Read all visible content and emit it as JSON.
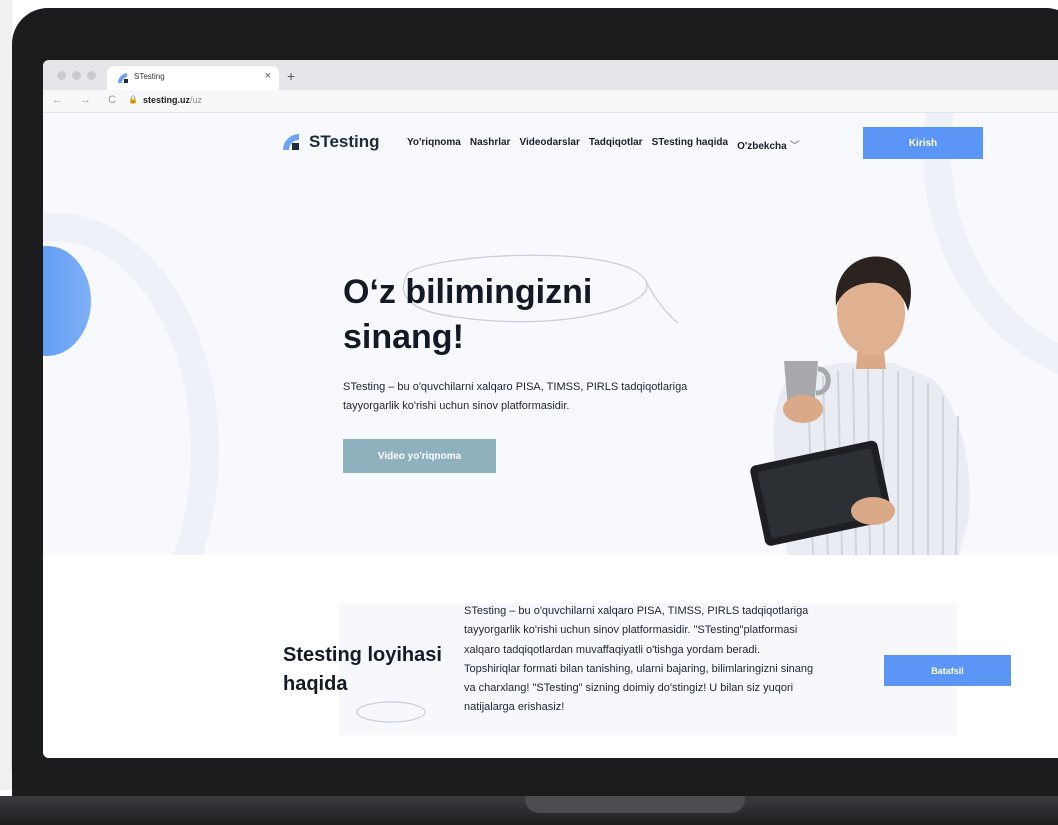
{
  "browser": {
    "tab_title": "STesting",
    "tab_close": "×",
    "new_tab": "+",
    "nav_buttons": "← → C",
    "url_domain": "stesting.uz",
    "url_path": "/uz"
  },
  "header": {
    "logo_text": "STesting",
    "menu": [
      {
        "label": "Yo'riqnoma"
      },
      {
        "label": "Nashrlar"
      },
      {
        "label": "Videodarslar"
      },
      {
        "label": "Tadqiqotlar"
      },
      {
        "label": "STesting haqida"
      },
      {
        "label": "O'zbekcha"
      }
    ],
    "lang_chevron": "﹀",
    "login_label": "Kirish"
  },
  "hero": {
    "title": "O‘z bilimingizni sinang!",
    "description": "STesting – bu o'quvchilarni xalqaro PISA, TIMSS, PIRLS tadqiqotlariga tayyorgarlik ko'rishi uchun sinov platformasidir.",
    "video_button": "Video yo'riqnoma"
  },
  "about": {
    "title": "Stesting loyihasi haqida",
    "text": "STesting – bu o'quvchilarni xalqaro PISA, TIMSS, PIRLS tadqiqotlariga tayyorgarlik ko'rishi uchun sinov platformasidir. \"STesting\"platformasi xalqaro tadqiqotlardan muvaffaqiyatli o'tishga yordam beradi. Topshiriqlar formati bilan tanishing, ularni bajaring, bilimlaringizni sinang va charxlang! \"STesting\" sizning doimiy do'stingiz! U bilan siz yuqori natijalarga erishasiz!",
    "more_button": "Batafsil"
  },
  "colors": {
    "primary_blue": "#5b95f5",
    "video_button": "#8fb1bd",
    "dark_text": "#141a25",
    "hero_bg": "#f7f9fc"
  },
  "icons": [
    "stesting-logo-icon",
    "lock-icon",
    "chevron-down-icon",
    "back-icon",
    "forward-icon",
    "reload-icon"
  ]
}
